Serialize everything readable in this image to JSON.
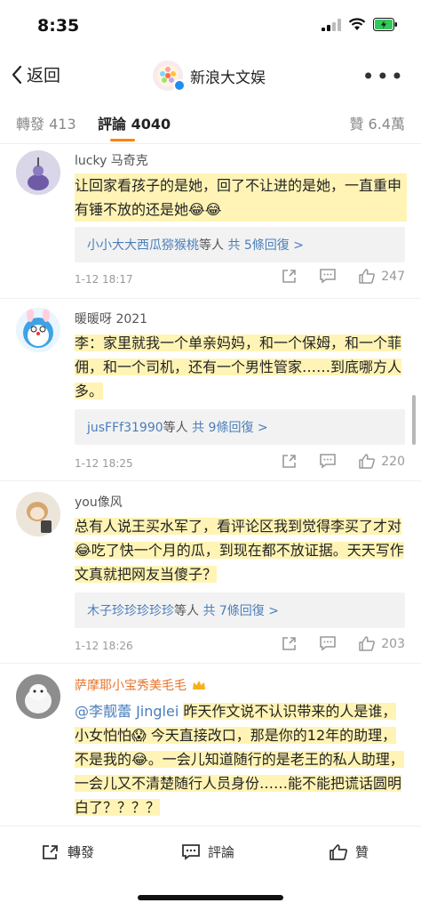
{
  "status_bar": {
    "time": "8:35"
  },
  "nav": {
    "back_label": "返回",
    "title": "新浪大文娱"
  },
  "tabs": {
    "repost": "轉發 413",
    "comment": "評論 4040",
    "like": "贊 6.4萬"
  },
  "comments": [
    {
      "user": "lucky 马奇克",
      "text": "让回家看孩子的是她，回了不让进的是她，一直重申有锤不放的还是她😂😂",
      "reply_who": "小小大大西瓜猕猴桃",
      "reply_mid": "等人",
      "reply_count": "共 5條回復 >",
      "time": "1-12 18:17",
      "likes": "247"
    },
    {
      "user": "暖暖呀 2021",
      "text": "李：家里就我一个单亲妈妈，和一个保姆，和一个菲佣，和一个司机，还有一个男性管家……到底哪方人多。",
      "reply_who": "jusFFf31990",
      "reply_mid": "等人",
      "reply_count": "共 9條回復 >",
      "time": "1-12 18:25",
      "likes": "220"
    },
    {
      "user": "you像风",
      "text": "总有人说王买水军了，看评论区我到觉得李买了才对😂吃了快一个月的瓜，到现在都不放证据。天天写作文真就把网友当傻子？",
      "reply_who": "木子珍珍珍珍珍",
      "reply_mid": "等人",
      "reply_count": "共 7條回復 >",
      "time": "1-12 18:26",
      "likes": "203"
    },
    {
      "user": "萨摩耶小宝秀美毛毛",
      "mention": "@李靓蕾 Jinglei",
      "text": "昨天作文说不认识带来的人是谁，小女怕怕😱 今天直接改口，那是你的12年的助理，不是我的😂。一会儿知道随行的是老王的私人助理，一会儿又不清楚随行人员身份……能不能把谎话圆明白了？？？？"
    }
  ],
  "bottom_bar": {
    "repost": "轉發",
    "comment": "評論",
    "like": "贊"
  },
  "colors": {
    "accent": "#ff8200",
    "link": "#4a7ebb",
    "highlight": "#ffeb78"
  }
}
